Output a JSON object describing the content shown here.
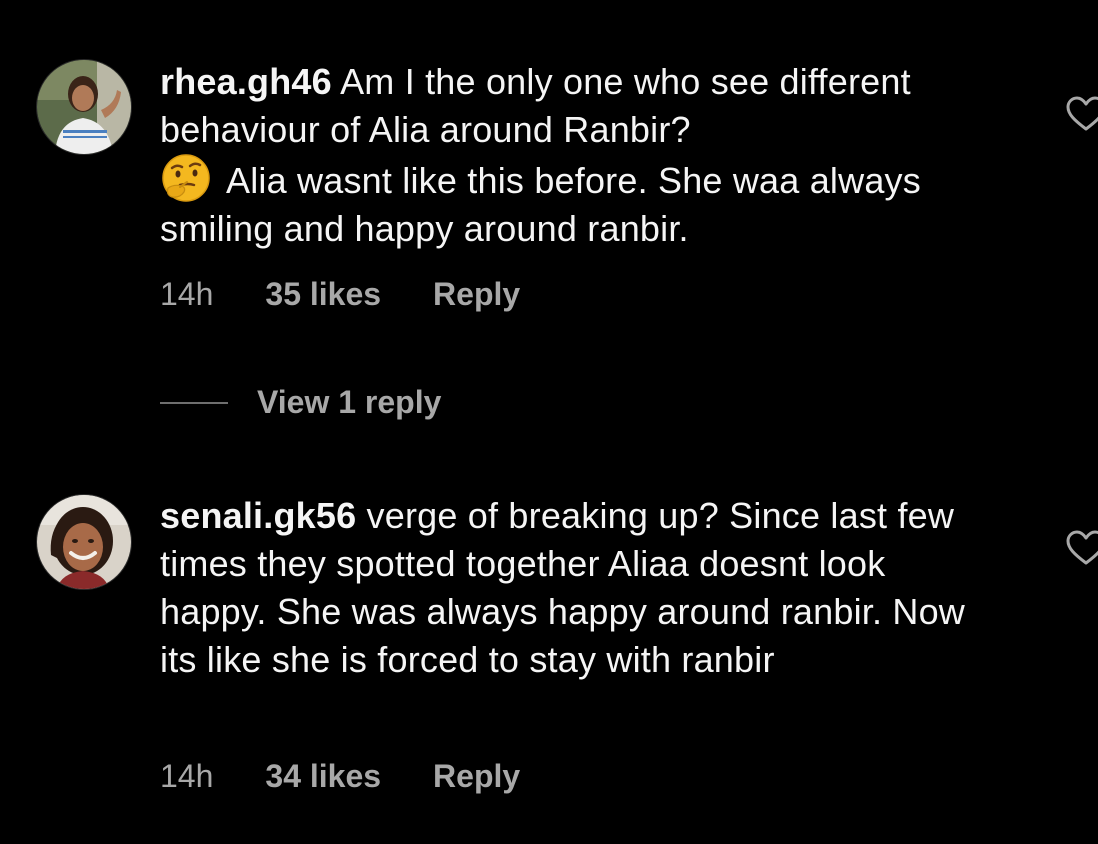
{
  "comments": [
    {
      "username": "rhea.gh46",
      "text_part1": "Am I the only one who see different behaviour of Alia around Ranbir?",
      "emoji": "thinking-face-emoji",
      "text_part2": "Alia wasnt like this before. She waa always smiling and happy around ranbir.",
      "time": "14h",
      "likes": "35 likes",
      "reply_label": "Reply"
    },
    {
      "username": "senali.gk56",
      "text": "verge of breaking up? Since last few times they spotted together Aliaa doesnt look happy. She was always happy around ranbir. Now its like she is forced to stay with ranbir",
      "time": "14h",
      "likes": "34 likes",
      "reply_label": "Reply"
    }
  ],
  "view_replies_label": "View 1 reply",
  "icons": {
    "like": "heart-icon",
    "thread": "thread-line"
  },
  "colors": {
    "background": "#000000",
    "text_primary": "#f5f5f5",
    "text_secondary": "#a8a8a8"
  }
}
